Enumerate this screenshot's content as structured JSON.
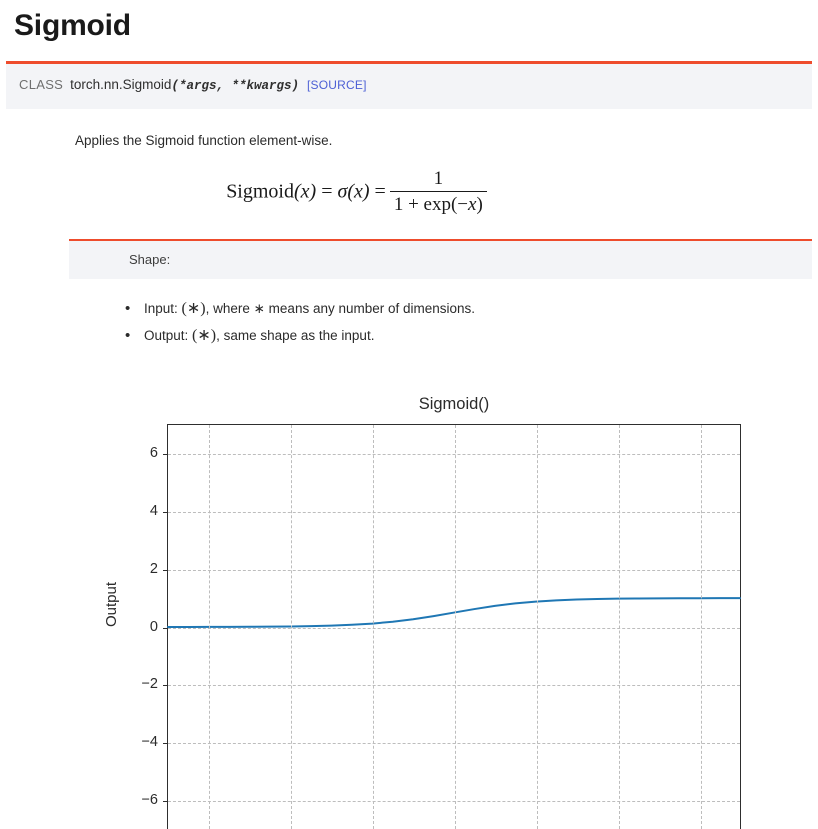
{
  "page": {
    "title": "Sigmoid",
    "accent_color": "#ee4c2c",
    "band_background": "#f3f4f7"
  },
  "signature": {
    "class_keyword": "CLASS",
    "qualified_name": "torch.nn.Sigmoid",
    "open_paren": "(",
    "params": "*args, **kwargs",
    "close_paren": ")",
    "source_link": "[SOURCE]",
    "source_link_color": "#4c5fd5"
  },
  "description": {
    "text": "Applies the Sigmoid function element-wise."
  },
  "formula": {
    "lhs_name": "Sigmoid",
    "lhs_arg": "(x)",
    "equals": "=",
    "sigma": "σ",
    "sigma_arg": "(x)",
    "equals2": "=",
    "numerator": "1",
    "denominator_prefix": "1 + exp(−",
    "denominator_var": "x",
    "denominator_suffix": ")"
  },
  "shape_section": {
    "heading": "Shape:",
    "items": [
      {
        "label": "Input: ",
        "symbol": "(∗)",
        "rest": ", where ∗ means any number of dimensions."
      },
      {
        "label": "Output: ",
        "symbol": "(∗)",
        "rest": ", same shape as the input."
      }
    ]
  },
  "chart_data": {
    "type": "line",
    "title": "Sigmoid()",
    "xlabel": "",
    "ylabel": "Output",
    "xlim": [
      -7,
      7
    ],
    "ylim": [
      -7,
      7
    ],
    "grid": true,
    "legend": false,
    "line_color": "#1f77b4",
    "line_width": 2,
    "yticks": [
      6,
      4,
      2,
      0,
      -2,
      -4,
      -6
    ],
    "ytick_labels": [
      "6",
      "4",
      "2",
      "0",
      "−2",
      "−4",
      "−6"
    ],
    "xticks": [
      -6,
      -4,
      -2,
      0,
      2,
      4,
      6
    ],
    "series": [
      {
        "name": "Sigmoid()",
        "x": [
          -7,
          -6.5,
          -6,
          -5.5,
          -5,
          -4.5,
          -4,
          -3.5,
          -3,
          -2.5,
          -2,
          -1.5,
          -1,
          -0.5,
          0,
          0.5,
          1,
          1.5,
          2,
          2.5,
          3,
          3.5,
          4,
          4.5,
          5,
          5.5,
          6,
          6.5,
          7
        ],
        "y": [
          0.0009,
          0.0015,
          0.0025,
          0.0041,
          0.0067,
          0.011,
          0.018,
          0.029,
          0.047,
          0.076,
          0.119,
          0.182,
          0.269,
          0.378,
          0.5,
          0.622,
          0.731,
          0.818,
          0.881,
          0.924,
          0.953,
          0.971,
          0.982,
          0.989,
          0.993,
          0.996,
          0.998,
          0.9985,
          0.9991
        ]
      }
    ]
  }
}
